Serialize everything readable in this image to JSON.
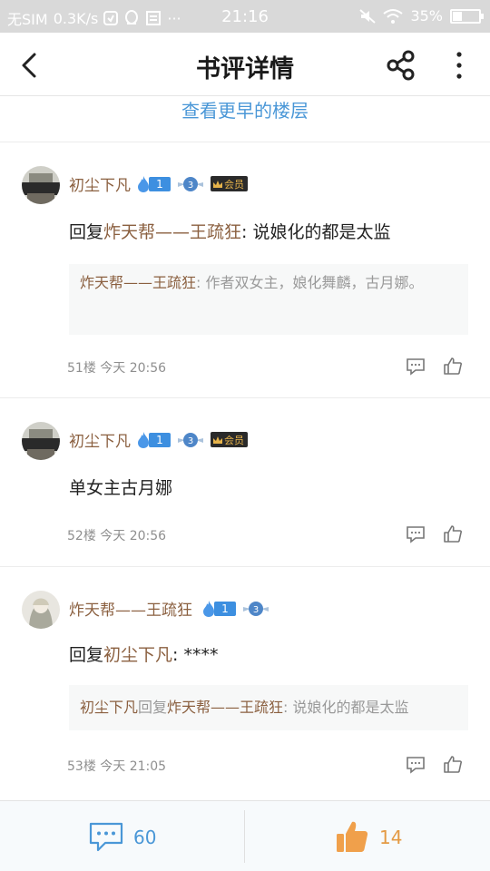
{
  "status_bar": {
    "carrier": "无SIM",
    "speed": "0.3K/s",
    "time": "21:16",
    "battery": "35%",
    "battery_level": 0.35
  },
  "header": {
    "title": "书评详情",
    "icons": [
      "back-arrow-icon",
      "share-icon",
      "more-vertical-icon"
    ]
  },
  "earlier_floors_label": "查看更早的楼层",
  "comments": [
    {
      "username": "初尘下凡",
      "level": "1",
      "rank_badge": "3",
      "vip_label": "会员",
      "reply_prefix": "回复",
      "reply_to": "炸天帮——王疏狂",
      "reply_text": ": 说娘化的都是太监",
      "quote_name": "炸天帮——王疏狂",
      "quote_text": ": 作者双女主，娘化舞麟，古月娜。",
      "floor": "51楼",
      "time": "今天 20:56"
    },
    {
      "username": "初尘下凡",
      "level": "1",
      "rank_badge": "3",
      "vip_label": "会员",
      "body": "单女主古月娜",
      "floor": "52楼",
      "time": "今天 20:56"
    },
    {
      "username": "炸天帮——王疏狂",
      "level": "1",
      "rank_badge": "3",
      "reply_prefix": "回复",
      "reply_to": "初尘下凡",
      "reply_text": ": ****",
      "quote_name": "初尘下凡",
      "quote_mid": "回复",
      "quote_name2": "炸天帮——王疏狂",
      "quote_text": ": 说娘化的都是太监",
      "floor": "53楼",
      "time": "今天 21:05"
    }
  ],
  "bottom_bar": {
    "comment_count": "60",
    "like_count": "14"
  },
  "colors": {
    "accent_blue": "#4a97d7",
    "username_brown": "#8b6040",
    "like_orange": "#e49a44"
  }
}
